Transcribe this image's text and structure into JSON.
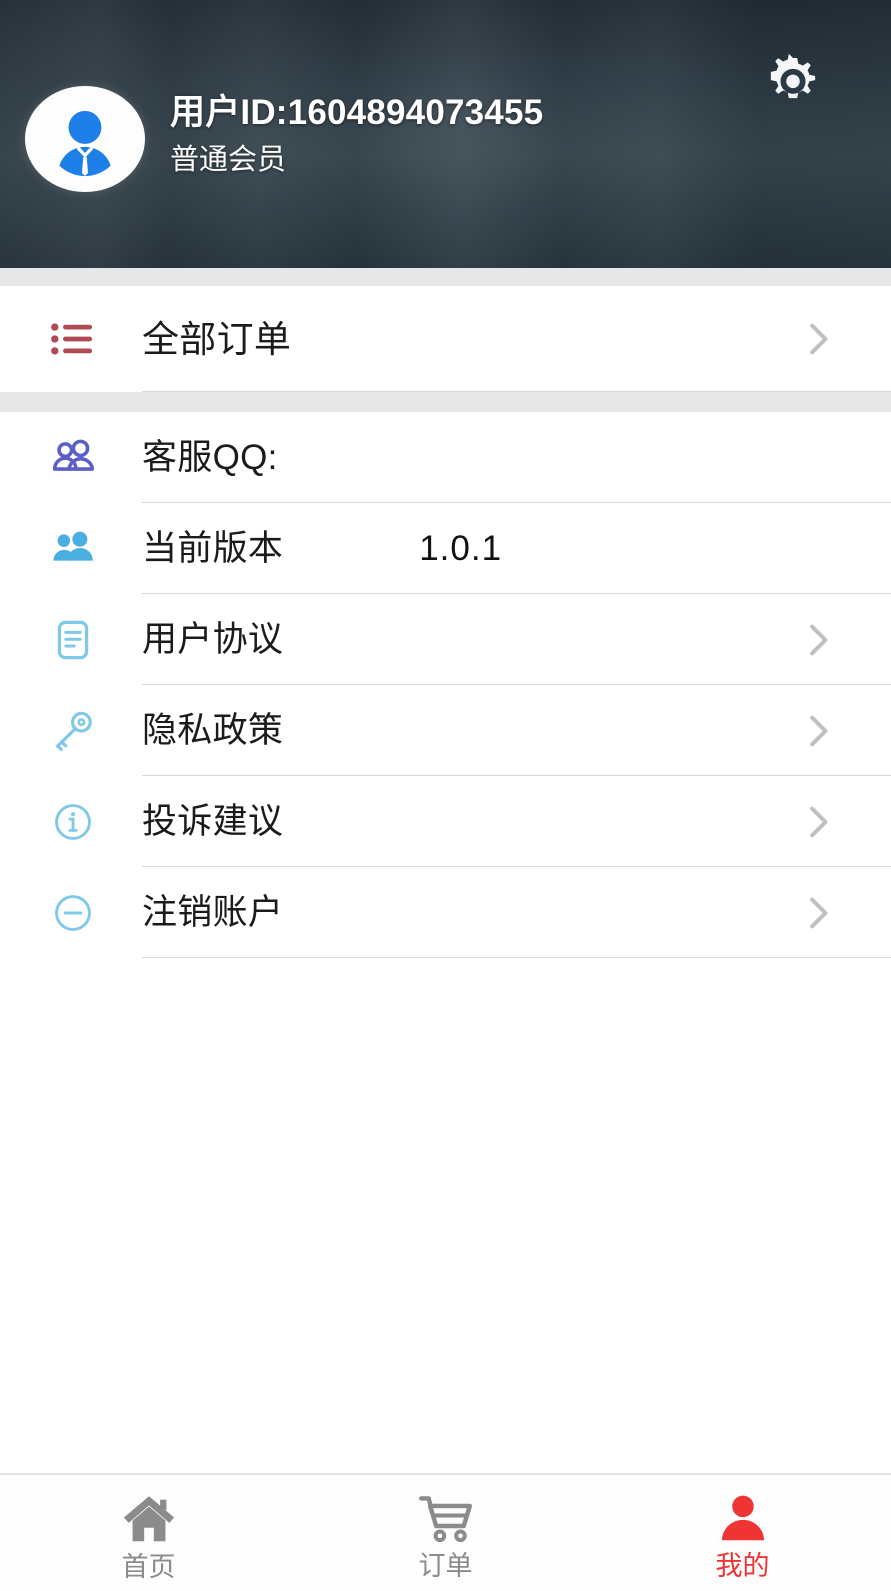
{
  "header": {
    "user_id": "用户ID:1604894073455",
    "member_level": "普通会员",
    "avatar_icon": "user-avatar-icon",
    "settings_icon": "gear-icon",
    "background_color": "#2b3a45"
  },
  "orders_group": {
    "items": [
      {
        "label": "全部订单",
        "icon": "list-icon",
        "icon_color": "#b04a55",
        "has_chevron": true,
        "value": ""
      }
    ]
  },
  "settings_group": {
    "items": [
      {
        "label": "客服QQ:",
        "icon": "people-outline-icon",
        "icon_color": "#5b5fc7",
        "has_chevron": false,
        "value": ""
      },
      {
        "label": "当前版本",
        "icon": "people-filled-icon",
        "icon_color": "#4aaee0",
        "has_chevron": false,
        "value": "1.0.1"
      },
      {
        "label": "用户协议",
        "icon": "document-icon",
        "icon_color": "#7ec8e8",
        "has_chevron": true,
        "value": ""
      },
      {
        "label": "隐私政策",
        "icon": "key-icon",
        "icon_color": "#7ec8e8",
        "has_chevron": true,
        "value": ""
      },
      {
        "label": "投诉建议",
        "icon": "info-circle-icon",
        "icon_color": "#7ec8e8",
        "has_chevron": true,
        "value": ""
      },
      {
        "label": "注销账户",
        "icon": "minus-circle-icon",
        "icon_color": "#7ec8e8",
        "has_chevron": true,
        "value": ""
      }
    ]
  },
  "tabbar": {
    "active_color": "#ef3434",
    "inactive_color": "#8b8b8b",
    "tabs": [
      {
        "label": "首页",
        "icon": "home-icon",
        "active": false
      },
      {
        "label": "订单",
        "icon": "cart-icon",
        "active": false
      },
      {
        "label": "我的",
        "icon": "person-icon",
        "active": true
      }
    ]
  }
}
